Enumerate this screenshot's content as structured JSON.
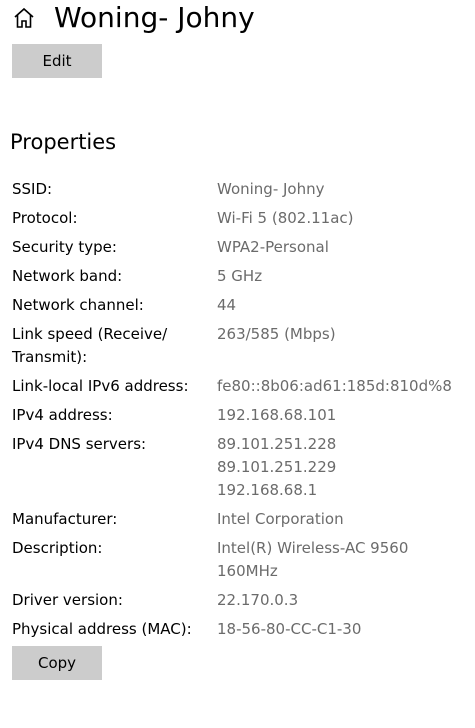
{
  "header": {
    "icon": "home-icon",
    "title": "Woning- Johny"
  },
  "buttons": {
    "edit": "Edit",
    "copy": "Copy"
  },
  "properties": {
    "title": "Properties",
    "rows": [
      {
        "label": "SSID:",
        "value": "Woning- Johny"
      },
      {
        "label": "Protocol:",
        "value": "Wi-Fi 5 (802.11ac)"
      },
      {
        "label": "Security type:",
        "value": "WPA2-Personal"
      },
      {
        "label": "Network band:",
        "value": "5 GHz"
      },
      {
        "label": "Network channel:",
        "value": "44"
      },
      {
        "label": "Link speed (Receive/\nTransmit):",
        "value": "263/585 (Mbps)"
      },
      {
        "label": "Link-local IPv6 address:",
        "value": "fe80::8b06:ad61:185d:810d%8"
      },
      {
        "label": "IPv4 address:",
        "value": "192.168.68.101"
      },
      {
        "label": "IPv4 DNS servers:",
        "value": "89.101.251.228\n89.101.251.229\n192.168.68.1"
      },
      {
        "label": "Manufacturer:",
        "value": "Intel Corporation"
      },
      {
        "label": "Description:",
        "value": "Intel(R) Wireless-AC 9560\n160MHz"
      },
      {
        "label": "Driver version:",
        "value": "22.170.0.3"
      },
      {
        "label": "Physical address (MAC):",
        "value": "18-56-80-CC-C1-30"
      }
    ]
  },
  "colors": {
    "label_text": "#000000",
    "value_text": "#6b6b6b",
    "button_bg": "#cccccc"
  }
}
